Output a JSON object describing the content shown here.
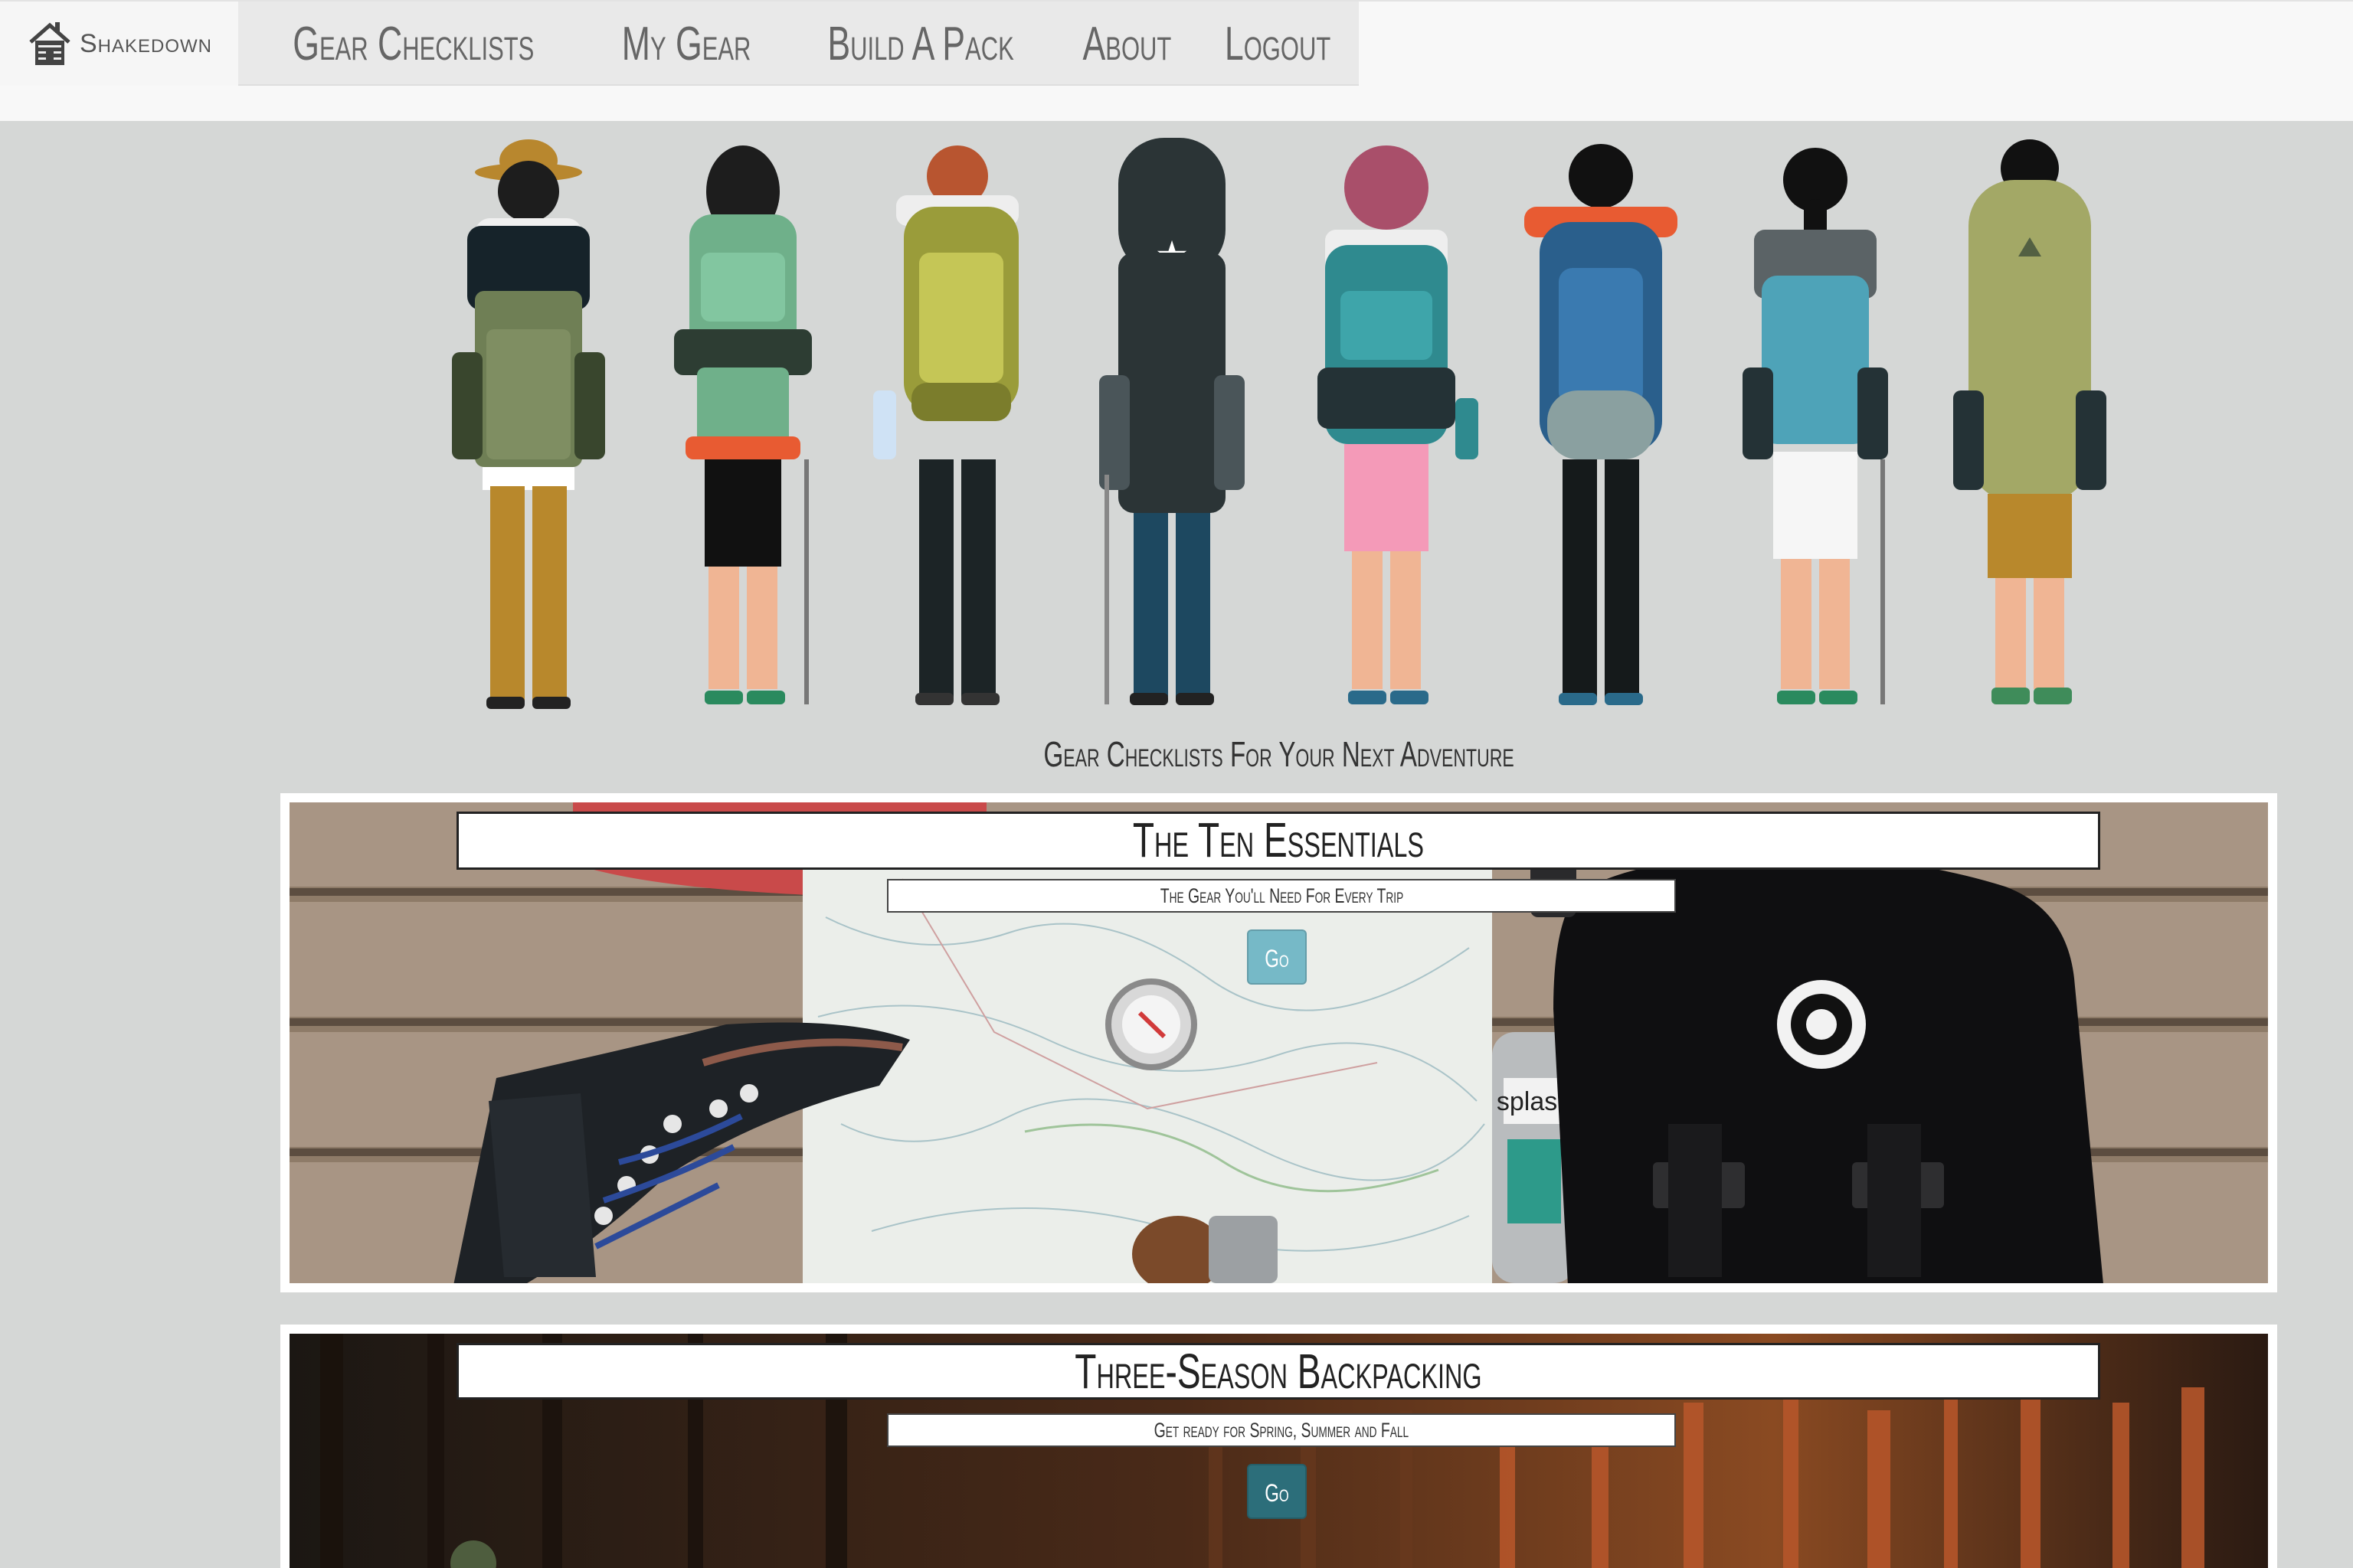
{
  "navbar": {
    "brand_label": "Shakedown",
    "brand_icon": "cabin-icon",
    "links": [
      "Gear Checklists",
      "My Gear",
      "Build A Pack",
      "About",
      "Logout"
    ]
  },
  "hero": {
    "illustration": "eight backpackers viewed from behind"
  },
  "tagline": "Gear Checklists For Your Next Adventure",
  "cards": [
    {
      "title": "The Ten Essentials",
      "subtitle": "The Gear You'll Need For Every Trip",
      "button": "Go"
    },
    {
      "title": "Three-Season Backpacking",
      "subtitle": "Get ready for Spring, Summer and Fall",
      "button": "Go"
    }
  ],
  "colors": {
    "page_bg": "#d5d7d6",
    "navbar_bg": "#f8f8f8",
    "go_button_1": "#76b9c7",
    "go_button_2": "#2c6e7a"
  }
}
